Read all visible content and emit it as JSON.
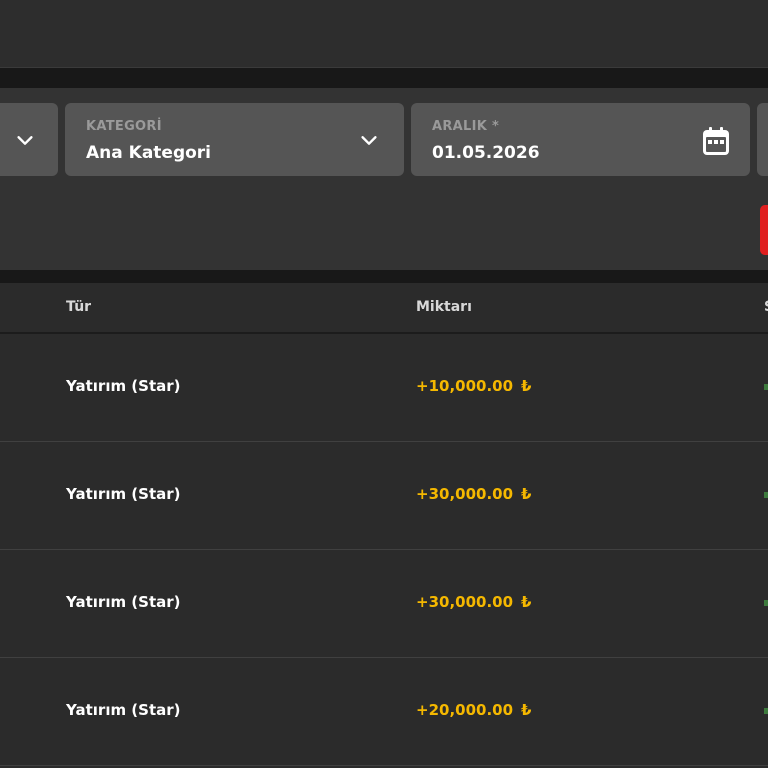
{
  "filters": {
    "category": {
      "label": "KATEGORİ",
      "value": "Ana Kategori"
    },
    "range": {
      "label": "ARALIK *",
      "value": "01.05.2026"
    }
  },
  "table": {
    "headers": {
      "type": "Tür",
      "amount": "Miktarı"
    },
    "rows": [
      {
        "type": "Yatırım (Star)",
        "amount": "+10,000.00",
        "currency": "₺"
      },
      {
        "type": "Yatırım (Star)",
        "amount": "+30,000.00",
        "currency": "₺"
      },
      {
        "type": "Yatırım (Star)",
        "amount": "+30,000.00",
        "currency": "₺"
      },
      {
        "type": "Yatırım (Star)",
        "amount": "+20,000.00",
        "currency": "₺"
      }
    ]
  },
  "colors": {
    "accent_amount": "#f5b800",
    "danger": "#e02020"
  },
  "icons": {
    "dropdown": "chevron-down-icon",
    "date": "calendar-icon"
  }
}
